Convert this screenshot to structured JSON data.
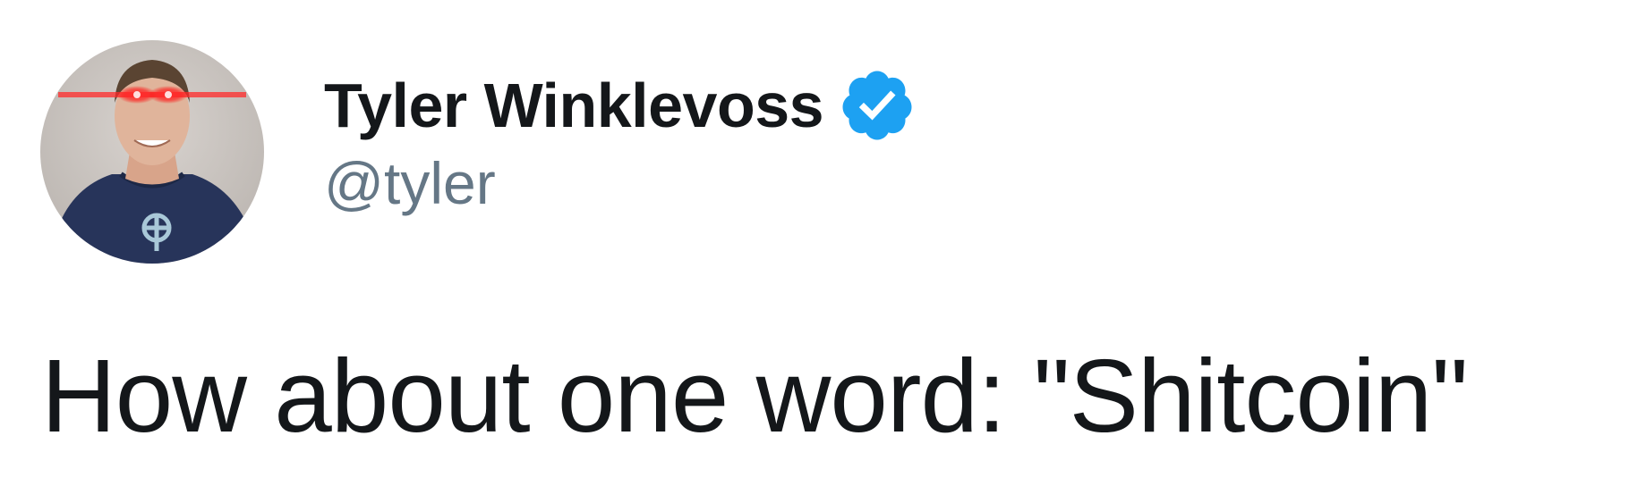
{
  "tweet": {
    "author": {
      "display_name": "Tyler Winklevoss",
      "handle": "@tyler",
      "verified": true,
      "avatar_icon": "profile-photo"
    },
    "text": "How about one word: \"Shitcoin\""
  },
  "colors": {
    "name": "#14171a",
    "handle": "#657786",
    "verified_badge": "#1da1f2",
    "text": "#14171a",
    "background": "#ffffff"
  }
}
